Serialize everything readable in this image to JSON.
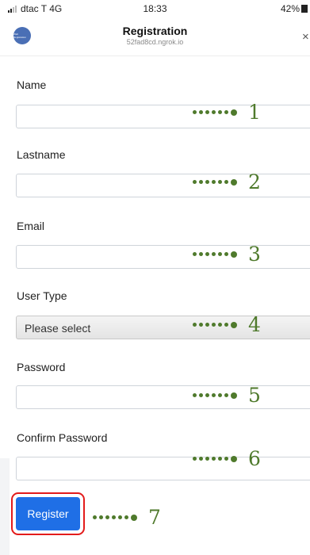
{
  "status_bar": {
    "carrier": "dtac T 4G",
    "time": "18:33",
    "battery": "42%"
  },
  "header": {
    "avatar_text": "Web Registration",
    "title": "Registration",
    "subtitle": "52fad8cd.ngrok.io",
    "close_glyph": "×"
  },
  "form": {
    "name": {
      "label": "Name",
      "value": "",
      "placeholder": ""
    },
    "lastname": {
      "label": "Lastname",
      "value": "",
      "placeholder": ""
    },
    "email": {
      "label": "Email",
      "value": "",
      "placeholder": ""
    },
    "user_type": {
      "label": "User Type",
      "selected": "Please select"
    },
    "password": {
      "label": "Password",
      "value": "",
      "placeholder": ""
    },
    "confirm_password": {
      "label": "Confirm Password",
      "value": "",
      "placeholder": ""
    },
    "register_label": "Register"
  },
  "annotations": [
    "1",
    "2",
    "3",
    "4",
    "5",
    "6",
    "7"
  ],
  "colors": {
    "button": "#1f6fe6",
    "highlight": "#e31b1b",
    "annotation": "#4f7a2c"
  }
}
